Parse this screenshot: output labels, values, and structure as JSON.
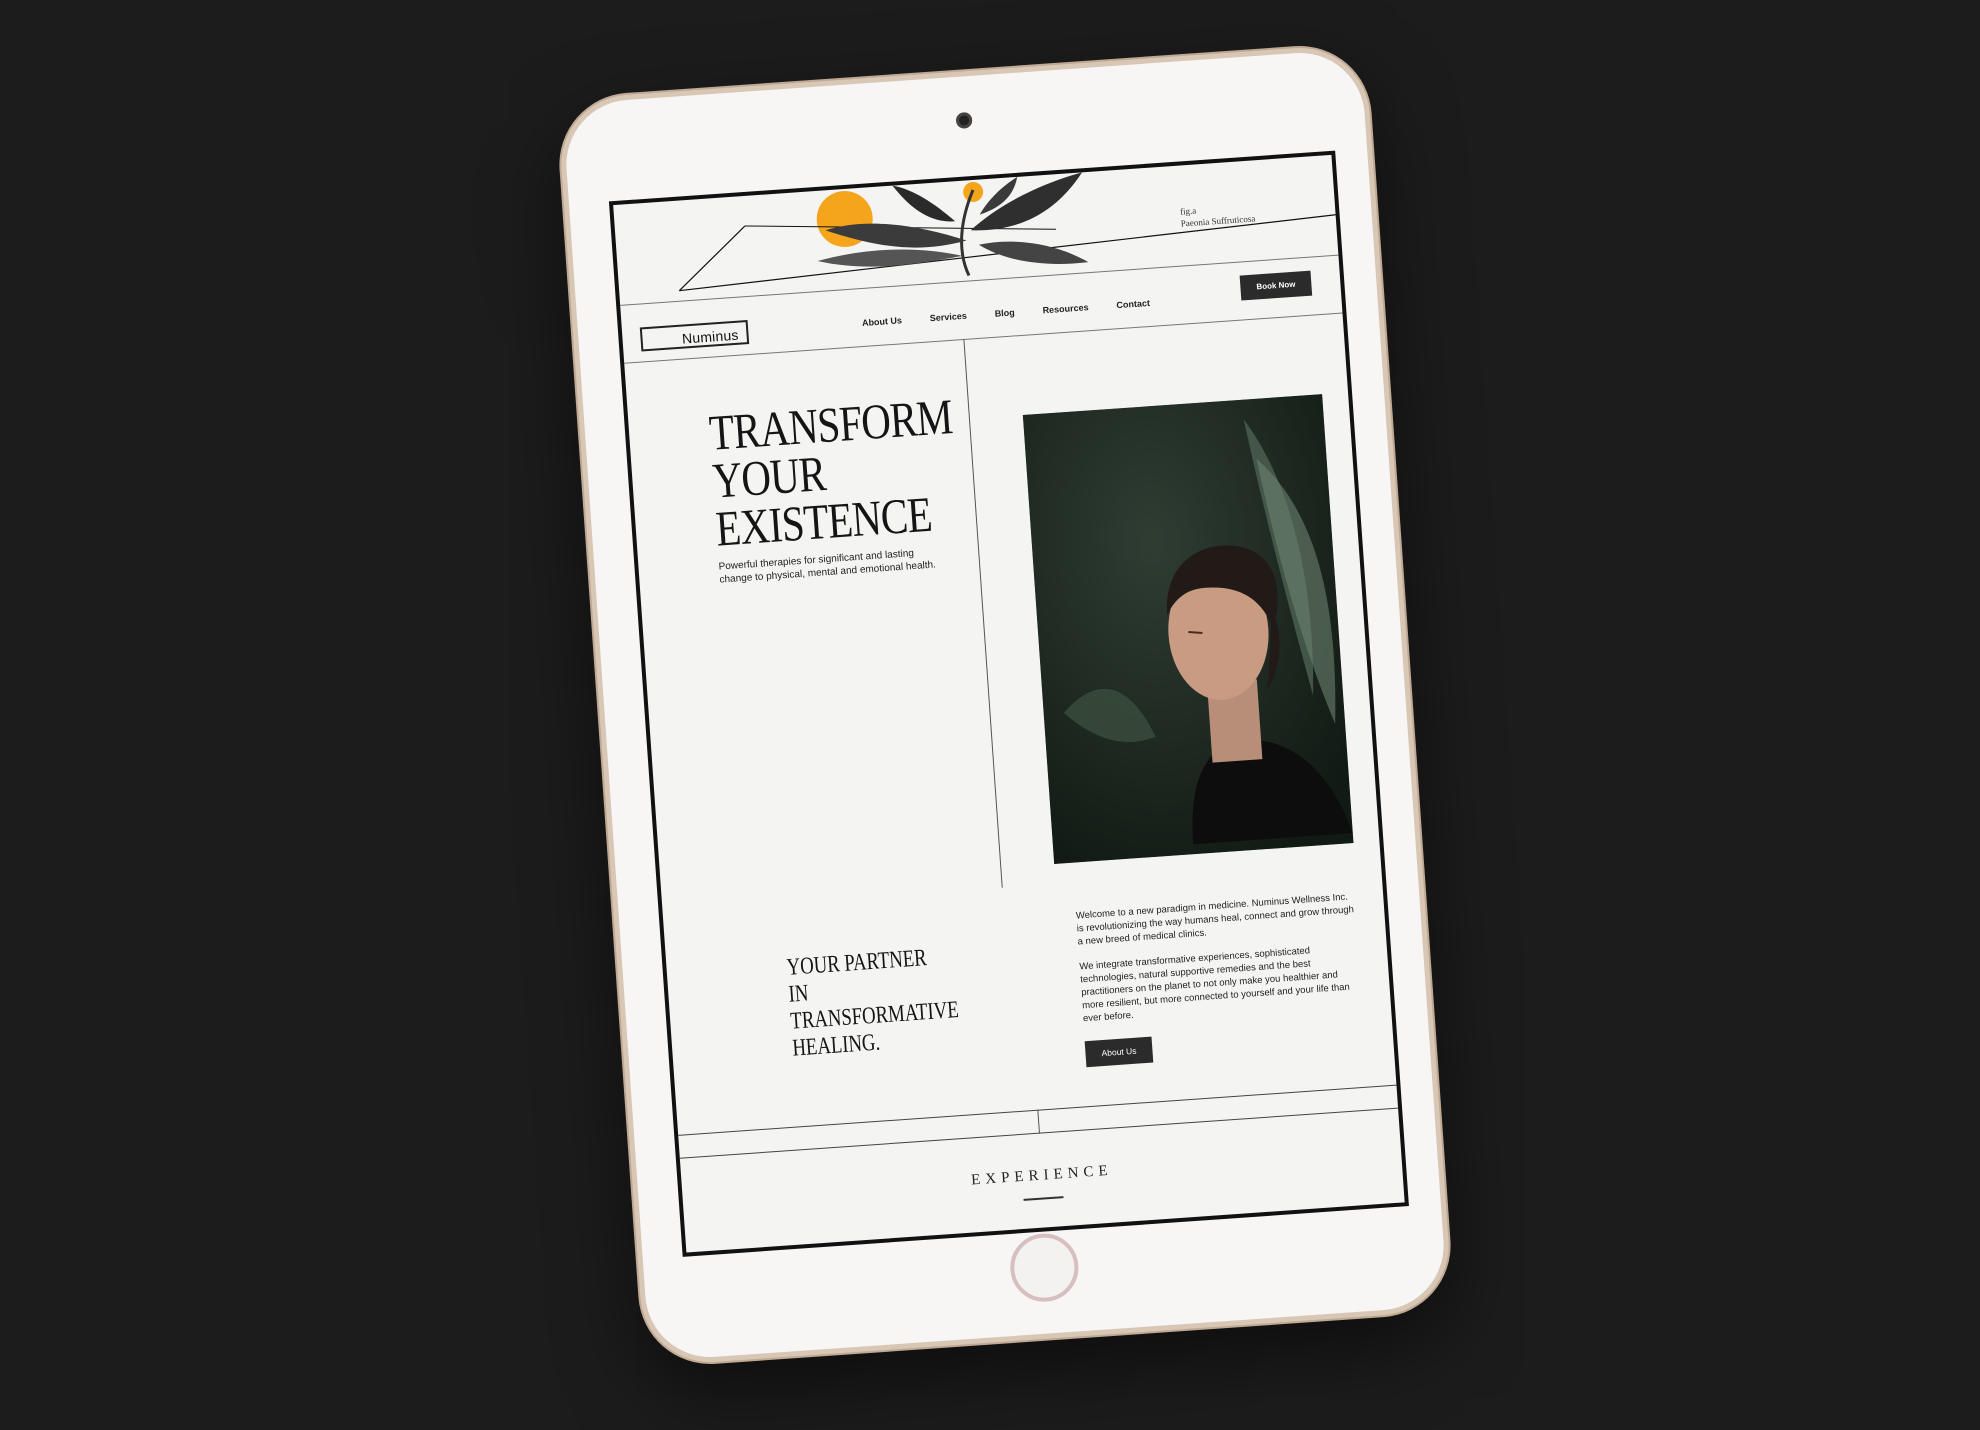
{
  "brand": {
    "logo": "Numinus"
  },
  "banner": {
    "fig_label": "fig.a",
    "fig_caption": "Paeonia Suffruticosa"
  },
  "nav": {
    "links": [
      "About Us",
      "Services",
      "Blog",
      "Resources",
      "Contact"
    ],
    "cta": "Book Now"
  },
  "hero": {
    "title_line1": "TRANSFORM",
    "title_line2": "YOUR",
    "title_line3": "EXISTENCE",
    "subtitle": "Powerful therapies for significant and lasting change to physical, mental and emotional health."
  },
  "partner": {
    "line1": "YOUR PARTNER",
    "line2": "IN TRANSFORMATIVE",
    "line3": "HEALING."
  },
  "intro": {
    "p1": "Welcome to a new paradigm in medicine. Numinus Wellness Inc. is revolutionizing the way humans heal, connect and grow through a new breed of medical clinics.",
    "p2": "We integrate transformative experiences, sophisticated technologies, natural supportive remedies and the best practitioners on the planet to not only make you healthier and more resilient, but more connected to yourself and your life than ever before.",
    "button": "About Us"
  },
  "section": {
    "experience": "EXPERIENCE"
  },
  "colors": {
    "background": "#1c1c1c",
    "screen": "#f4f4f3",
    "accent_orange": "#f4a51c",
    "button_dark": "#2b2b2b",
    "tablet_bezel": "#f7f6f4",
    "tablet_rim": "#d9c7b6"
  }
}
